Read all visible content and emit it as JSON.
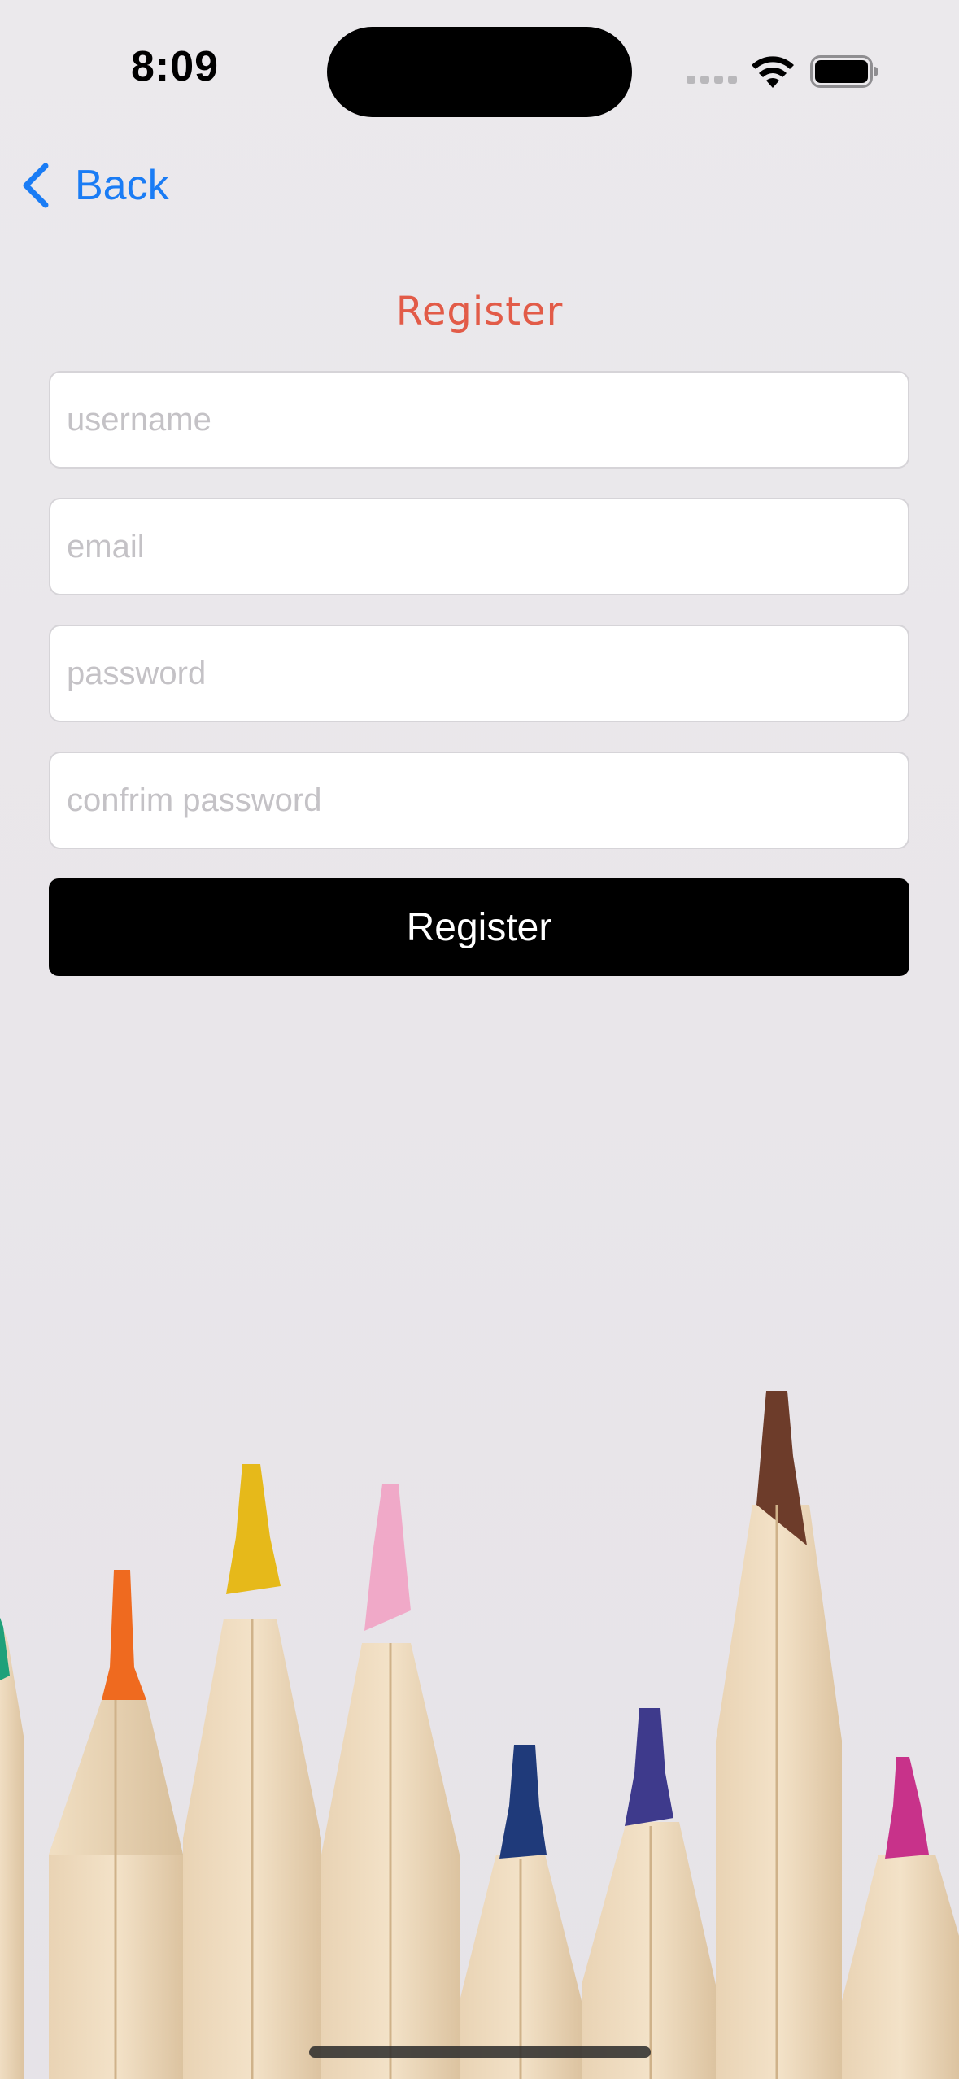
{
  "status_bar": {
    "time": "8:09"
  },
  "nav": {
    "back_label": "Back"
  },
  "form": {
    "title": "Register",
    "fields": [
      {
        "name": "username",
        "placeholder": "username",
        "value": ""
      },
      {
        "name": "email",
        "placeholder": "email",
        "value": ""
      },
      {
        "name": "password",
        "placeholder": "password",
        "value": ""
      },
      {
        "name": "confirm_password",
        "placeholder": "confrim password",
        "value": ""
      }
    ],
    "submit_label": "Register"
  },
  "colors": {
    "title": "#e25b48",
    "back_link": "#1a7cf5",
    "button_bg": "#000000",
    "button_text": "#ffffff",
    "background": "#ebe9ec"
  },
  "icons": {
    "back": "chevron-left-icon",
    "signal": "cellular-signal-icon",
    "wifi": "wifi-icon",
    "battery": "battery-icon"
  }
}
